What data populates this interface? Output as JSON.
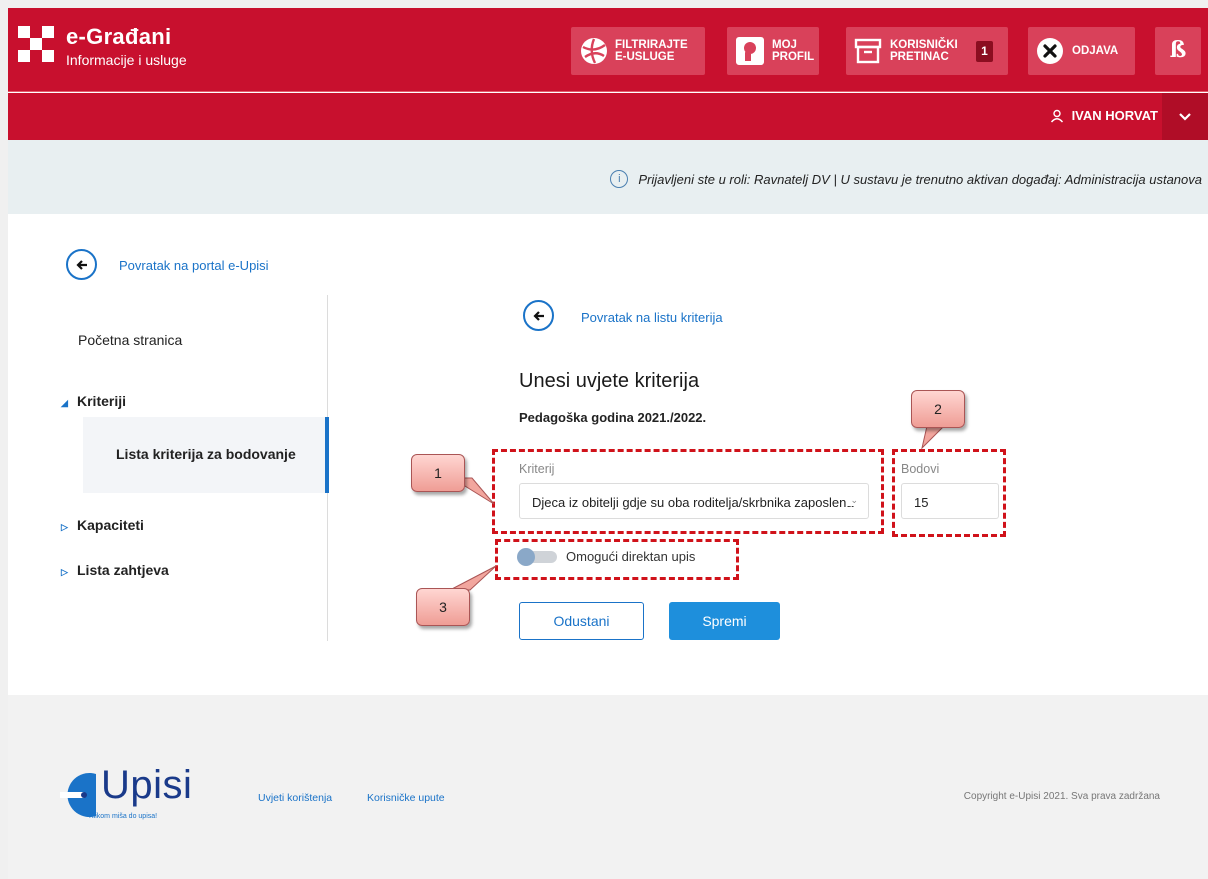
{
  "header": {
    "brand_title": "e-Građani",
    "brand_subtitle": "Informacije i usluge",
    "btn_filter": "FILTRIRAJTE E-USLUGE",
    "btn_profile": "MOJ PROFIL",
    "btn_inbox": "KORISNIČKI PRETINAC",
    "inbox_count": "1",
    "btn_logout": "ODJAVA",
    "user_name": "IVAN HORVAT"
  },
  "info": {
    "text": "Prijavljeni ste u roli: Ravnatelj DV | U sustavu je trenutno aktivan događaj: Administracija ustanova"
  },
  "nav": {
    "back_portal": "Povratak na portal e-Upisi",
    "home": "Početna stranica",
    "section_kriteriji": "Kriteriji",
    "active_item": "Lista kriterija za bodovanje",
    "section_kapaciteti": "Kapaciteti",
    "section_zahtjevi": "Lista zahtjeva"
  },
  "main": {
    "back_list": "Povratak na listu kriterija",
    "title": "Unesi uvjete kriterija",
    "year": "Pedagoška godina 2021./2022.",
    "criterion_label": "Kriterij",
    "criterion_value": "Djeca iz obitelji gdje su oba roditelja/skrbnika zaposlena",
    "points_label": "Bodovi",
    "points_value": "15",
    "toggle_label": "Omogući direktan upis",
    "toggle_on": false,
    "cancel_label": "Odustani",
    "save_label": "Spremi"
  },
  "annotations": {
    "callout_1": "1",
    "callout_2": "2",
    "callout_3": "3"
  },
  "footer": {
    "logo_text": "Upisi",
    "logo_tagline": "Klikom miša do upisa!",
    "link_terms": "Uvjeti korištenja",
    "link_manual": "Korisničke upute",
    "copyright": "Copyright e-Upisi 2021. Sva prava zadržana"
  },
  "colors": {
    "brand_red": "#c8102e",
    "accent_blue": "#1a73c8",
    "annotation_red": "#d0121a"
  }
}
